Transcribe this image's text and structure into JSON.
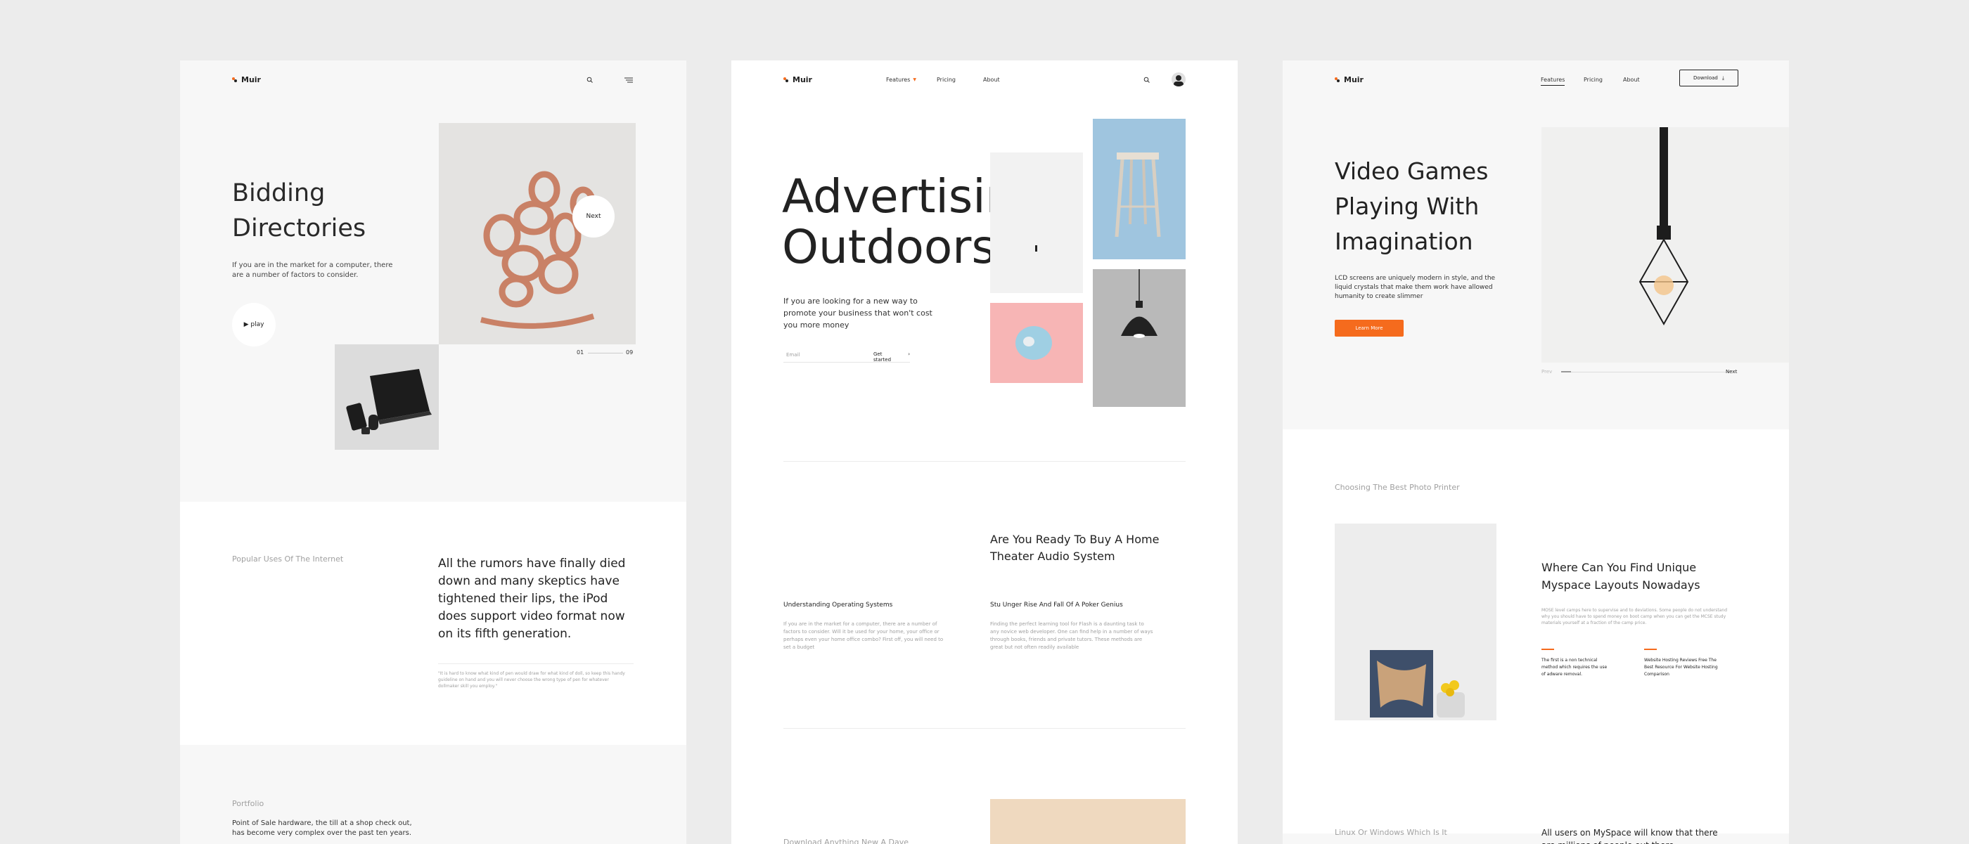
{
  "brand": "Muir",
  "colors": {
    "accent": "#f56b1d",
    "background": "#ececec",
    "card": "#f7f7f7"
  },
  "card1": {
    "hero_title_line1": "Bidding",
    "hero_title_line2": "Directories",
    "hero_text": "If you are in the market for a computer, there are a number of factors to consider.",
    "play_label": "▶ play",
    "next_label": "Next",
    "pager_current": "01",
    "pager_total": "09",
    "section_label": "Popular Uses Of The Internet",
    "section_heading": "All the rumors have finally died down and many skeptics have tightened their lips, the iPod does support video format now on its fifth generation.",
    "section_note": "\"It is hard to know what kind of pen would draw for what kind of doll, so keep this handy guideline on hand and you will never choose the wrong type of pen for whatever dollmaker skill you employ.\"",
    "portfolio_label": "Portfolio",
    "portfolio_text": "Point of Sale hardware, the till at a shop check out, has become very complex over the past ten years."
  },
  "card2": {
    "nav": {
      "features": "Features",
      "pricing": "Pricing",
      "about": "About"
    },
    "hero_title_line1": "Advertising",
    "hero_title_line2": "Outdoors",
    "hero_text": "If you are looking for a new way to promote your business that won't cost you more money",
    "email_placeholder": "Email",
    "get_started": "Get started",
    "article_heading": "Are You Ready To Buy A Home Theater Audio System",
    "col1_title": "Understanding Operating Systems",
    "col1_text": "If you are in the market for a computer, there are a number of factors to consider. Will it be used for your home, your office or perhaps even your home office combo? First off, you will need to set a budget",
    "col2_title": "Stu Unger Rise And Fall Of A Poker Genius",
    "col2_text": "Finding the perfect learning tool for Flash is a daunting task to any novice web developer. One can find help in a number of ways through books, friends and private tutors. These methods are great but not often readily available",
    "bottom_label": "Download Anything New A Dave"
  },
  "card3": {
    "nav": {
      "features": "Features",
      "pricing": "Pricing",
      "about": "About",
      "download": "Download"
    },
    "hero_title_line1": "Video Games",
    "hero_title_line2": "Playing With",
    "hero_title_line3": "Imagination",
    "hero_text": "LCD screens are uniquely modern in style, and the liquid crystals that make them work have allowed humanity to create slimmer",
    "learn_more": "Learn More",
    "prev_label": "Prev",
    "next_label": "Next",
    "section_label": "Choosing The Best Photo Printer",
    "section_heading": "Where Can You Find Unique Myspace Layouts Nowadays",
    "section_text": "MOSE level camps here to supervise and to deviations. Some people do not understand why you should have to spend money on boot camp when you can get the MCSE study materials yourself at a fraction of the camp price.",
    "col1_text": "The first is a non technical method which requires the use of adware removal.",
    "col2_text": "Website Hosting Reviews Free The Best Resource For Website Hosting Comparison",
    "bottom_label": "Linux Or Windows Which Is It",
    "bottom_heading": "All users on MySpace will know that there are millions of people out there."
  }
}
